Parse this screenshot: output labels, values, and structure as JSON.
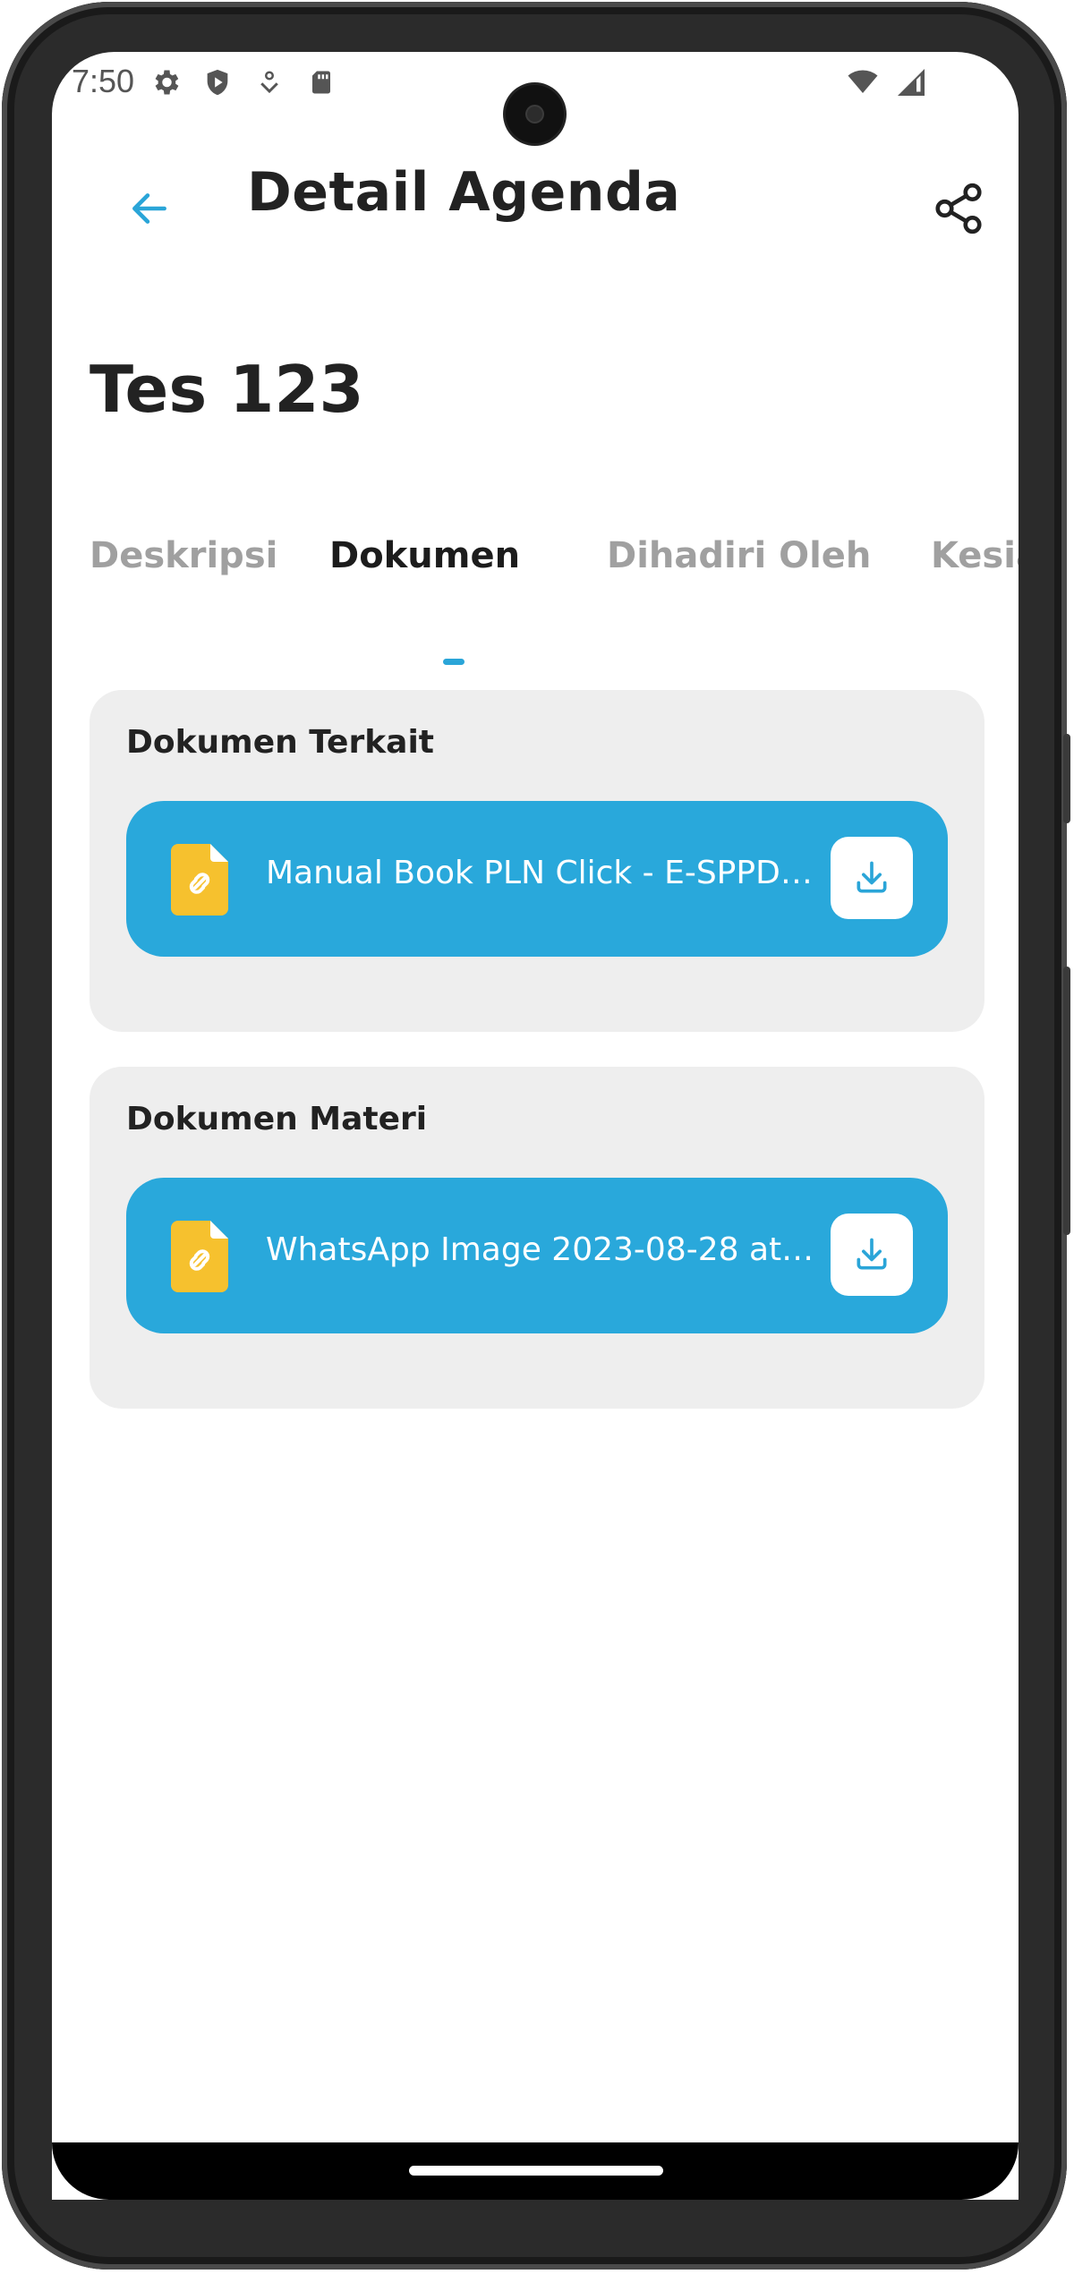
{
  "status_bar": {
    "time": "7:50",
    "left_icons": [
      "gear-icon",
      "shield-icon",
      "location-icon",
      "sd-card-icon"
    ],
    "right_icons": [
      "wifi-icon",
      "signal-icon"
    ]
  },
  "header": {
    "title": "Detail Agenda",
    "back_icon": "arrow-left-icon",
    "share_icon": "share-icon",
    "accent_color": "#2aa5d8"
  },
  "agenda": {
    "title": "Tes 123"
  },
  "tabs": [
    {
      "label": "Deskripsi",
      "active": false
    },
    {
      "label": "Dokumen",
      "active": true
    },
    {
      "label": "Dihadiri Oleh",
      "active": false
    },
    {
      "label": "Kesiapa",
      "active": false
    }
  ],
  "sections": [
    {
      "title": "Dokumen Terkait",
      "documents": [
        {
          "name": "Manual Book PLN Click - E-SPPD ...",
          "icon": "file-link-icon",
          "action_icon": "download-icon"
        }
      ]
    },
    {
      "title": "Dokumen Materi",
      "documents": [
        {
          "name": "WhatsApp Image 2023-08-28 at ...",
          "icon": "file-link-icon",
          "action_icon": "download-icon"
        }
      ]
    }
  ],
  "colors": {
    "doc_item_bg": "#29a8db",
    "file_icon": "#f6c12e",
    "card_bg": "#eeeeee"
  }
}
